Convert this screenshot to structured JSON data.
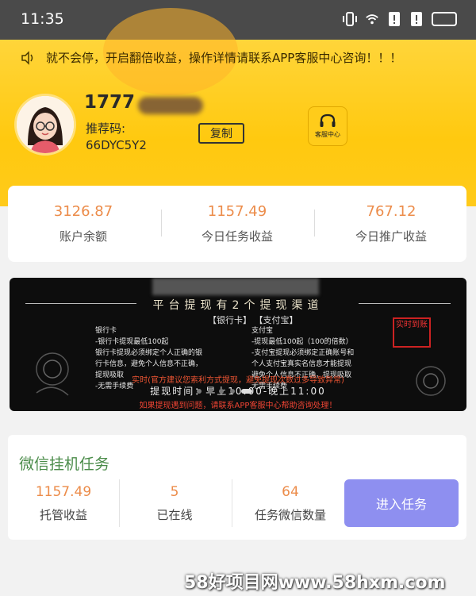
{
  "status_bar": {
    "time": "11:35"
  },
  "header": {
    "notice": "就不会停，开启翻倍收益，操作详情请联系APP客服中心咨询！！！",
    "phone_visible": "1777",
    "referral_label": "推荐码:",
    "referral_code": "66DYC5Y2",
    "copy_label": "复制",
    "service_label": "客服中心"
  },
  "stats": [
    {
      "value": "3126.87",
      "label": "账户余额"
    },
    {
      "value": "1157.49",
      "label": "今日任务收益"
    },
    {
      "value": "767.12",
      "label": "今日推广收益"
    }
  ],
  "banner": {
    "title": "平台提现有2个提现渠道",
    "tabs": "【银行卡】 【支付宝】",
    "left_lines": [
      "银行卡",
      "-银行卡提现最低100起",
      "银行卡提现必须绑定个人正确的银",
      "行卡信息，避免个人信息不正确，",
      "提现吸取",
      "-无需手续费"
    ],
    "right_lines": [
      "支付宝",
      "-提现最低100起（100的倍数）",
      "-支付宝提现必须绑定正确账号和",
      "个人支付宝真实名信息才能提现",
      "避免个人信息不正确，提现吸取",
      "无需手续费"
    ],
    "stamp": "实时到账",
    "notice_red": "实时(官方建议您索利方式提现，避免提现次数过多导致异常)",
    "time_text": "提现时间：早上10:00-晚上11:00",
    "footer_red": "如果提现遇到问题，请联系APP客服中心帮助咨询处理！"
  },
  "task": {
    "title": "微信挂机任务",
    "stats": [
      {
        "value": "1157.49",
        "label": "托管收益"
      },
      {
        "value": "5",
        "label": "已在线"
      },
      {
        "value": "64",
        "label": "任务微信数量"
      }
    ],
    "enter_label": "进入任务"
  },
  "watermark": "58好项目网www.58hxm.com",
  "colors": {
    "header": "#ffc90f",
    "accent_value": "#ec8c4a",
    "button": "#8e8ff0",
    "task_title": "#4b8c4a"
  }
}
